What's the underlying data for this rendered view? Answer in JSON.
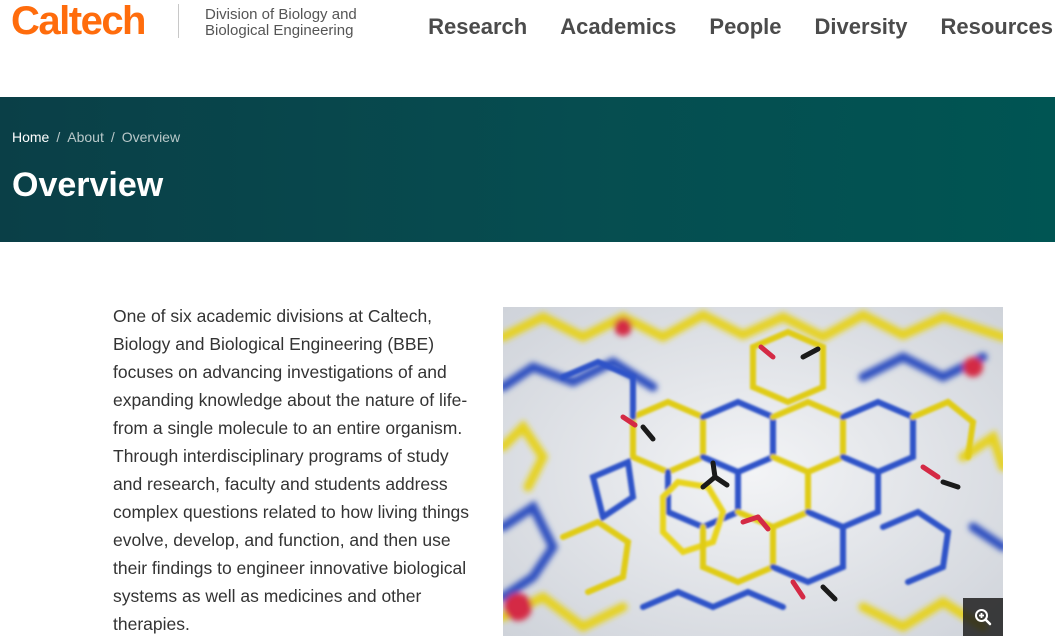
{
  "header": {
    "logo": "Caltech",
    "division_line1": "Division of Biology and",
    "division_line2": "Biological Engineering",
    "nav": [
      "Research",
      "Academics",
      "People",
      "Diversity",
      "Resources"
    ]
  },
  "breadcrumb": {
    "home": "Home",
    "separator": "/",
    "about": "About",
    "current": "Overview"
  },
  "page_title": "Overview",
  "intro_text": "One of six academic divisions at Caltech, Biology and Biological Engineering (BBE) focuses on advancing investigations of and expanding knowledge about the nature of life- from a single molecule to an entire organism. Through interdisciplinary programs of study and research, faculty and students address complex questions related to how living things evolve, develop, and function, and then use their findings to engineer innovative biological systems as well as medicines and other therapies.",
  "figure": {
    "zoom_icon": "zoom-in-icon"
  },
  "colors": {
    "brand_orange": "#ff6c0c",
    "hero_start": "#0a3f47",
    "hero_end": "#005553"
  }
}
